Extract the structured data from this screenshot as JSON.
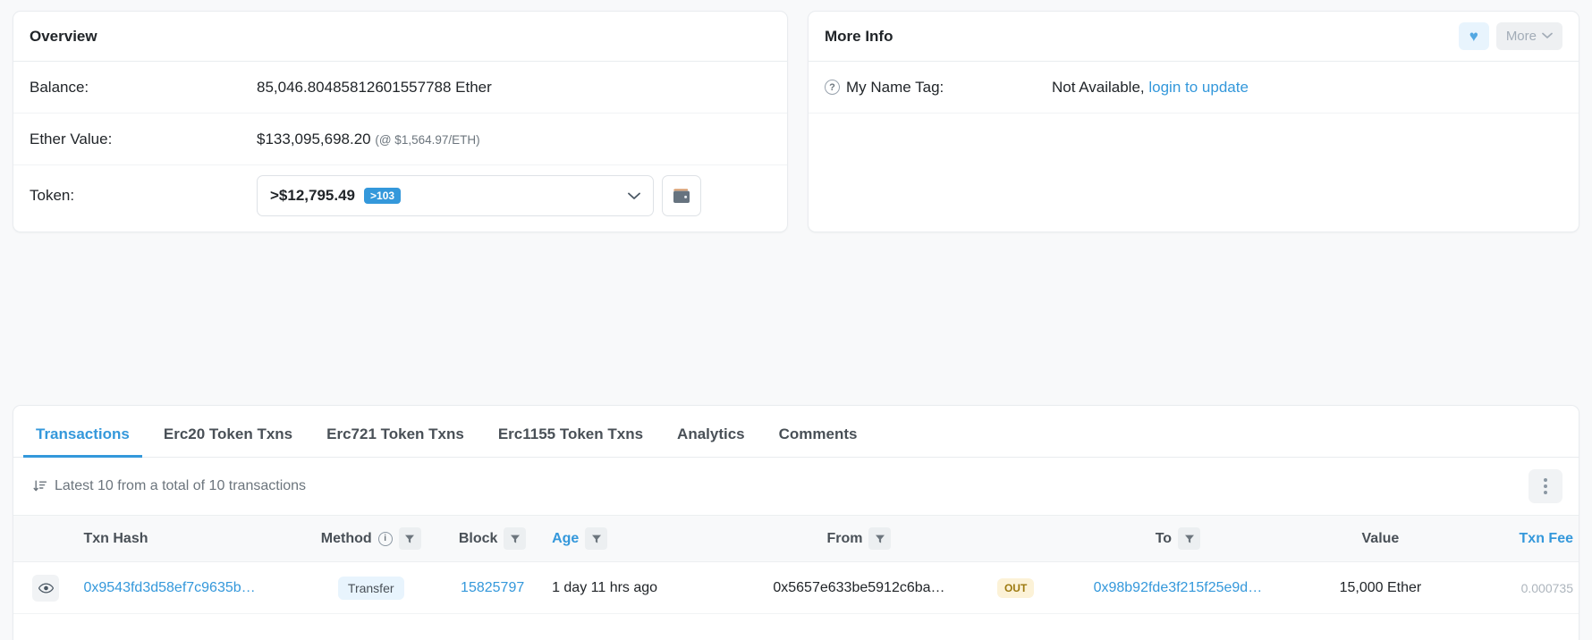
{
  "overview": {
    "title": "Overview",
    "balance_label": "Balance:",
    "balance_value": "85,046.80485812601557788 Ether",
    "ether_value_label": "Ether Value:",
    "ether_value": "$133,095,698.20",
    "ether_rate": "(@ $1,564.97/ETH)",
    "token_label": "Token:",
    "token_amount": ">$12,795.49",
    "token_badge": ">103",
    "chevron": "⌄",
    "wallet_icon": "wallet-icon"
  },
  "more_info": {
    "title": "More Info",
    "heart_icon": "♥",
    "more_label": "More",
    "more_chevron": "⌄",
    "name_tag_label": "My Name Tag:",
    "name_tag_help": "?",
    "name_tag_value": "Not Available,",
    "name_tag_link": "login to update"
  },
  "tabs": [
    {
      "label": "Transactions",
      "active": true
    },
    {
      "label": "Erc20 Token Txns",
      "active": false
    },
    {
      "label": "Erc721 Token Txns",
      "active": false
    },
    {
      "label": "Erc1155 Token Txns",
      "active": false
    },
    {
      "label": "Analytics",
      "active": false
    },
    {
      "label": "Comments",
      "active": false
    }
  ],
  "summary": {
    "sort_icon": "↓≡",
    "text": "Latest 10 from a total of 10 transactions",
    "menu_icon": "vertical-dots-icon"
  },
  "table": {
    "columns": {
      "txn_hash": "Txn Hash",
      "method": "Method",
      "block": "Block",
      "age": "Age",
      "from": "From",
      "to": "To",
      "value": "Value",
      "txn_fee": "Txn Fee"
    },
    "rows": [
      {
        "hash": "0x9543fd3d58ef7c9635b…",
        "method": "Transfer",
        "block": "15825797",
        "age": "1 day 11 hrs ago",
        "from": "0x5657e633be5912c6ba…",
        "direction": "OUT",
        "to": "0x98b92fde3f215f25e9d…",
        "value": "15,000 Ether",
        "fee": "0.000735"
      }
    ]
  },
  "colors": {
    "accent": "#3498db",
    "out_badge_bg": "#fcf2d7",
    "out_badge_fg": "#9d7a10",
    "method_bg": "#e8f4fd",
    "page_bg": "#f8f9fa"
  }
}
